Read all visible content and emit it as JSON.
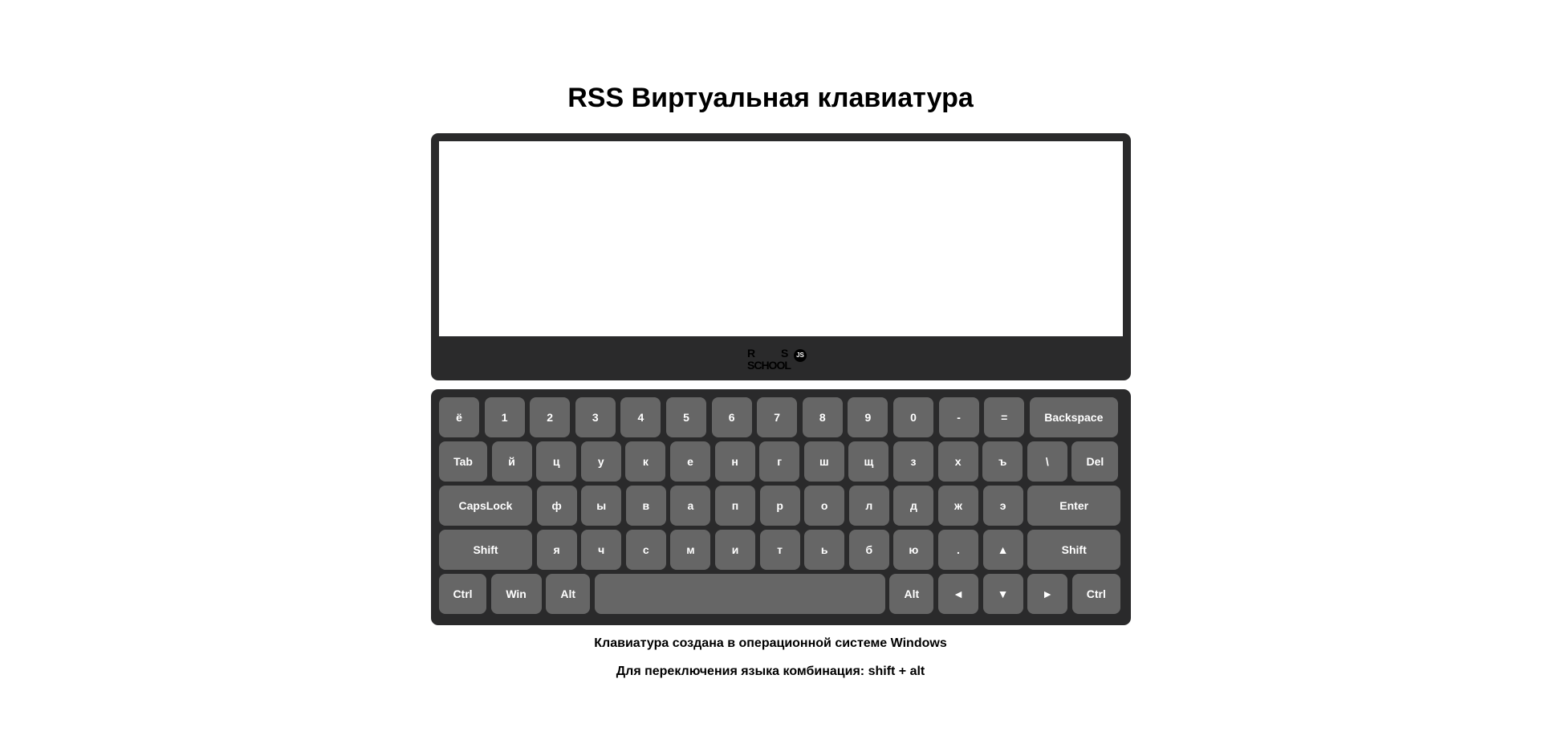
{
  "title": "RSS Виртуальная клавиатура",
  "textarea": {
    "value": "",
    "placeholder": ""
  },
  "logo": {
    "line1_left": "R",
    "line1_right": "S",
    "badge": "JS",
    "line2": "SCHOOL"
  },
  "keyboard": {
    "rows": [
      [
        {
          "id": "Backquote",
          "label": "ё"
        },
        {
          "id": "Digit1",
          "label": "1"
        },
        {
          "id": "Digit2",
          "label": "2"
        },
        {
          "id": "Digit3",
          "label": "3"
        },
        {
          "id": "Digit4",
          "label": "4"
        },
        {
          "id": "Digit5",
          "label": "5"
        },
        {
          "id": "Digit6",
          "label": "6"
        },
        {
          "id": "Digit7",
          "label": "7"
        },
        {
          "id": "Digit8",
          "label": "8"
        },
        {
          "id": "Digit9",
          "label": "9"
        },
        {
          "id": "Digit0",
          "label": "0"
        },
        {
          "id": "Minus",
          "label": "-"
        },
        {
          "id": "Equal",
          "label": "="
        },
        {
          "id": "Backspace",
          "label": "Backspace"
        }
      ],
      [
        {
          "id": "Tab",
          "label": "Tab"
        },
        {
          "id": "KeyQ",
          "label": "й"
        },
        {
          "id": "KeyW",
          "label": "ц"
        },
        {
          "id": "KeyE",
          "label": "у"
        },
        {
          "id": "KeyR",
          "label": "к"
        },
        {
          "id": "KeyT",
          "label": "е"
        },
        {
          "id": "KeyY",
          "label": "н"
        },
        {
          "id": "KeyU",
          "label": "г"
        },
        {
          "id": "KeyI",
          "label": "ш"
        },
        {
          "id": "KeyO",
          "label": "щ"
        },
        {
          "id": "KeyP",
          "label": "з"
        },
        {
          "id": "BracketLeft",
          "label": "х"
        },
        {
          "id": "BracketRight",
          "label": "ъ"
        },
        {
          "id": "Backslash",
          "label": "\\"
        },
        {
          "id": "Delete",
          "label": "Del"
        }
      ],
      [
        {
          "id": "CapsLock",
          "label": "CapsLock"
        },
        {
          "id": "KeyA",
          "label": "ф"
        },
        {
          "id": "KeyS",
          "label": "ы"
        },
        {
          "id": "KeyD",
          "label": "в"
        },
        {
          "id": "KeyF",
          "label": "а"
        },
        {
          "id": "KeyG",
          "label": "п"
        },
        {
          "id": "KeyH",
          "label": "р"
        },
        {
          "id": "KeyJ",
          "label": "о"
        },
        {
          "id": "KeyK",
          "label": "л"
        },
        {
          "id": "KeyL",
          "label": "д"
        },
        {
          "id": "Semicolon",
          "label": "ж"
        },
        {
          "id": "Quote",
          "label": "э"
        },
        {
          "id": "Enter",
          "label": "Enter"
        }
      ],
      [
        {
          "id": "ShiftLeft",
          "label": "Shift"
        },
        {
          "id": "KeyZ",
          "label": "я"
        },
        {
          "id": "KeyX",
          "label": "ч"
        },
        {
          "id": "KeyC",
          "label": "с"
        },
        {
          "id": "KeyV",
          "label": "м"
        },
        {
          "id": "KeyB",
          "label": "и"
        },
        {
          "id": "KeyN",
          "label": "т"
        },
        {
          "id": "KeyM",
          "label": "ь"
        },
        {
          "id": "Comma",
          "label": "б"
        },
        {
          "id": "Period",
          "label": "ю"
        },
        {
          "id": "Slash",
          "label": "."
        },
        {
          "id": "ArrowUp",
          "label": "▲"
        },
        {
          "id": "ShiftRight",
          "label": "Shift"
        }
      ],
      [
        {
          "id": "ControlLeft",
          "label": "Ctrl"
        },
        {
          "id": "MetaLeft",
          "label": "Win"
        },
        {
          "id": "AltLeft",
          "label": "Alt"
        },
        {
          "id": "Space",
          "label": ""
        },
        {
          "id": "AltRight",
          "label": "Alt"
        },
        {
          "id": "ArrowLeft",
          "label": "◄"
        },
        {
          "id": "ArrowDown",
          "label": "▼"
        },
        {
          "id": "ArrowRight",
          "label": "►"
        },
        {
          "id": "ControlRight",
          "label": "Ctrl"
        }
      ]
    ]
  },
  "info": {
    "os_note": "Клавиатура создана в операционной системе Windows",
    "lang_note": "Для переключения языка комбинация: shift + alt"
  },
  "colors": {
    "frame": "#2a2a2b",
    "key": "#666666",
    "key_text": "#ffffff",
    "screen": "#ffffff"
  }
}
